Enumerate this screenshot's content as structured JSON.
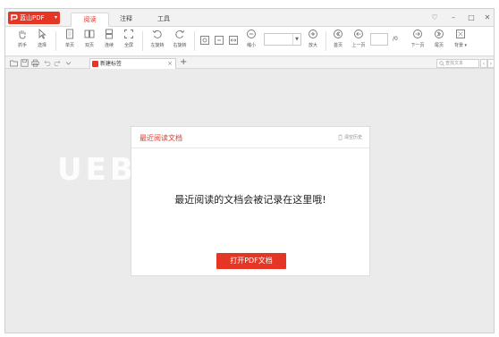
{
  "app": {
    "logo_text": "蓝山PDF",
    "logo_caret": "▾"
  },
  "menu_tabs": [
    {
      "label": "阅读",
      "active": true
    },
    {
      "label": "注释",
      "active": false
    },
    {
      "label": "工具",
      "active": false
    }
  ],
  "window_controls": {
    "menu": "♡",
    "minimize": "–",
    "maximize": "□",
    "close": "✕"
  },
  "toolbar": {
    "hand": "抓手",
    "select": "选择",
    "single_page": "单页",
    "double_page": "双页",
    "continuous": "连续",
    "fullscreen": "全屏",
    "rotate_left": "左旋转",
    "rotate_right": "右旋转",
    "zoom_out": "缩小",
    "zoom_in": "放大",
    "first_page": "首页",
    "prev_page": "上一页",
    "page_total": "/0",
    "next_page": "下一页",
    "last_page": "尾页",
    "background": "背景 ▾",
    "zoom_value": ""
  },
  "tabstrip": {
    "doc_tab_title": "新建标签",
    "doc_tab_close": "×",
    "add_tab": "+",
    "search_placeholder": "查找文本",
    "prev_result": "‹",
    "next_result": "›"
  },
  "watermark": "UEBU",
  "recent_panel": {
    "title": "最近阅读文档",
    "clear_history": "清空历史",
    "empty_message": "最近阅读的文档会被记录在这里哦!",
    "open_button": "打开PDF文档"
  },
  "colors": {
    "accent": "#e53524",
    "background": "#ebebeb"
  }
}
